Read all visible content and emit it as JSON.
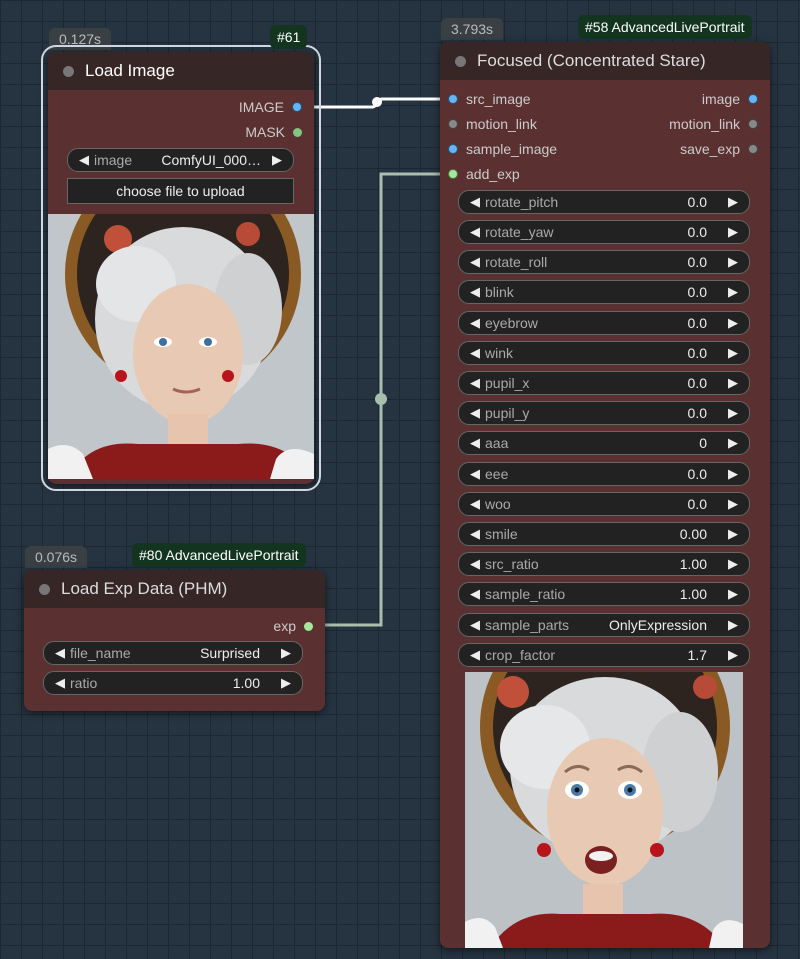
{
  "node61": {
    "timing": "0.127s",
    "badge": "#61",
    "title": "Load Image",
    "outputs": [
      "IMAGE",
      "MASK"
    ],
    "image_widget": {
      "name": "image",
      "value": "ComfyUI_000…"
    },
    "upload_label": "choose file to upload"
  },
  "node80": {
    "timing": "0.076s",
    "badge": "#80 AdvancedLivePortrait",
    "title": "Load Exp Data (PHM)",
    "output": "exp",
    "widgets": [
      {
        "name": "file_name",
        "value": "Surprised"
      },
      {
        "name": "ratio",
        "value": "1.00"
      }
    ]
  },
  "node58": {
    "timing": "3.793s",
    "badge": "#58 AdvancedLivePortrait",
    "title": "Focused (Concentrated Stare)",
    "inputs": [
      "src_image",
      "motion_link",
      "sample_image",
      "add_exp"
    ],
    "outputs": [
      "image",
      "motion_link",
      "save_exp"
    ],
    "widgets": [
      {
        "name": "rotate_pitch",
        "value": "0.0"
      },
      {
        "name": "rotate_yaw",
        "value": "0.0"
      },
      {
        "name": "rotate_roll",
        "value": "0.0"
      },
      {
        "name": "blink",
        "value": "0.0"
      },
      {
        "name": "eyebrow",
        "value": "0.0"
      },
      {
        "name": "wink",
        "value": "0.0"
      },
      {
        "name": "pupil_x",
        "value": "0.0"
      },
      {
        "name": "pupil_y",
        "value": "0.0"
      },
      {
        "name": "aaa",
        "value": "0"
      },
      {
        "name": "eee",
        "value": "0.0"
      },
      {
        "name": "woo",
        "value": "0.0"
      },
      {
        "name": "smile",
        "value": "0.00"
      },
      {
        "name": "src_ratio",
        "value": "1.00"
      },
      {
        "name": "sample_ratio",
        "value": "1.00"
      },
      {
        "name": "sample_parts",
        "value": "OnlyExpression"
      },
      {
        "name": "crop_factor",
        "value": "1.7"
      }
    ]
  },
  "colors": {
    "canvas": "#263340",
    "node_body": "#5a3030",
    "node_header": "#372626",
    "badge_bg": "#133520",
    "image_slot": "#64b5f6",
    "mask_slot": "#81c784",
    "link_image": "#ffffff",
    "link_exp": "#a9bfae"
  },
  "icons": {
    "arrow_left": "◀",
    "arrow_right": "▶"
  }
}
